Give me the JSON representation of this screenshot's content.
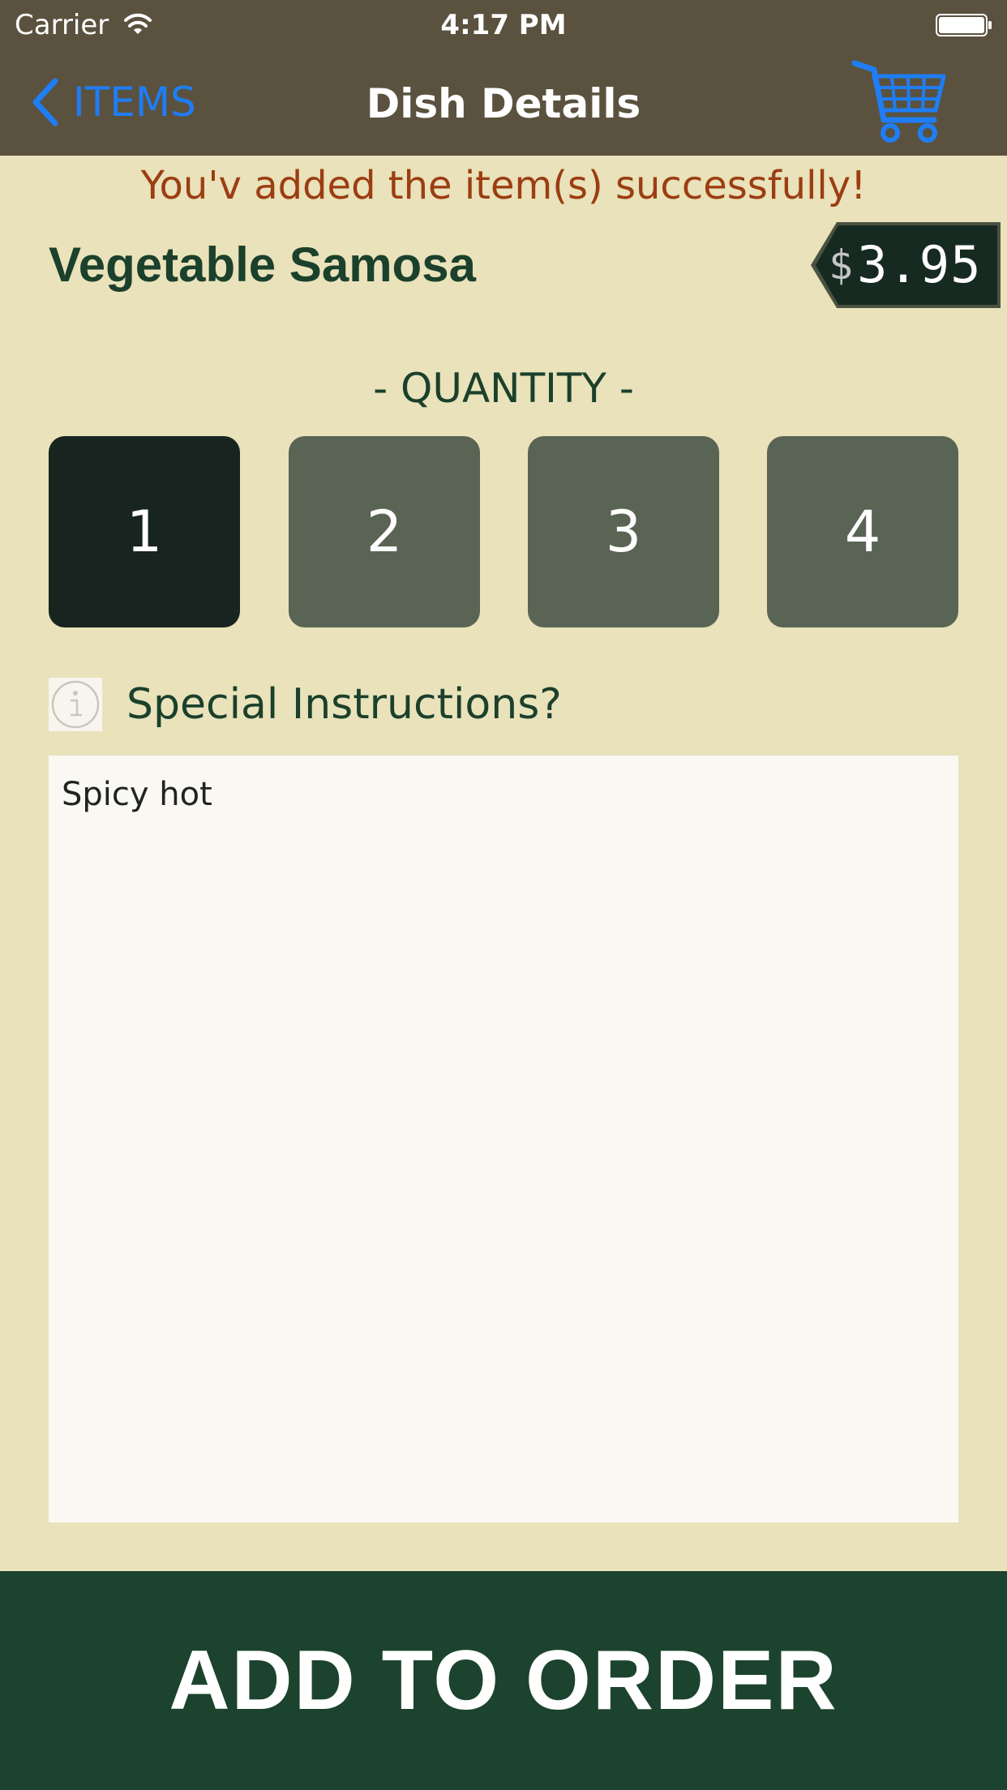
{
  "status_bar": {
    "carrier": "Carrier",
    "time": "4:17 PM",
    "icons": [
      "wifi-icon",
      "battery-icon"
    ]
  },
  "nav": {
    "back_label": "ITEMS",
    "title": "Dish Details",
    "cart_icon": "cart-icon",
    "accent_color": "#1f7df5"
  },
  "success_message": "You'v added the item(s) successfully!",
  "dish": {
    "name": "Vegetable Samosa",
    "currency": "$",
    "price": "3.95"
  },
  "quantity": {
    "label": "- QUANTITY -",
    "options": [
      "1",
      "2",
      "3",
      "4"
    ],
    "selected": "1"
  },
  "instructions": {
    "label": "Special Instructions?",
    "value": "Spicy hot"
  },
  "add_button_label": "ADD TO ORDER",
  "colors": {
    "bar": "#5a523f",
    "background": "#e9e2ba",
    "primary_green": "#1c432d",
    "message": "#9c3d12",
    "quantity_selected": "#17241f",
    "quantity_default": "#5a6454"
  }
}
